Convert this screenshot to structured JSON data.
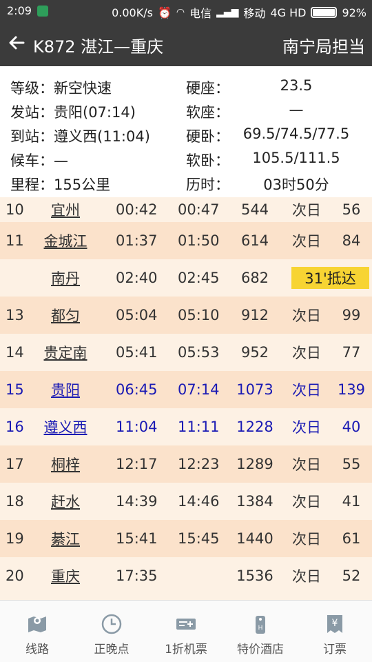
{
  "statusbar": {
    "time": "2:09",
    "speed": "0.00K/s",
    "carrier1": "电信",
    "carrier2": "移动",
    "network": "4G HD",
    "battery": "92%"
  },
  "appbar": {
    "title": "K872 湛江—重庆",
    "bureau": "南宁局担当"
  },
  "info": {
    "rows": [
      {
        "left": "等级：新空快速",
        "right_label": "硬座：",
        "right_value": "23.5"
      },
      {
        "left": "发站：贵阳(07:14)",
        "right_label": "软座：",
        "right_value": "—"
      },
      {
        "left": "到站：遵义西(11:04)",
        "right_label": "硬卧：",
        "right_value": "69.5/74.5/77.5"
      },
      {
        "left": "候车：—",
        "right_label": "软卧：",
        "right_value": "105.5/111.5"
      },
      {
        "left": "里程：155公里",
        "right_label": "历时：",
        "right_value": "03时50分"
      }
    ]
  },
  "stops": [
    {
      "num": "10",
      "name": "宜州",
      "arr": "00:42",
      "dep": "00:47",
      "km": "544",
      "day": "次日",
      "extra": "56"
    },
    {
      "num": "11",
      "name": "金城江",
      "arr": "01:37",
      "dep": "01:50",
      "km": "614",
      "day": "次日",
      "extra": "84"
    },
    {
      "num": "",
      "name": "南丹",
      "arr": "02:40",
      "dep": "02:45",
      "km": "682",
      "badge": "31'抵达"
    },
    {
      "num": "13",
      "name": "都匀",
      "arr": "05:04",
      "dep": "05:10",
      "km": "912",
      "day": "次日",
      "extra": "99"
    },
    {
      "num": "14",
      "name": "贵定南",
      "arr": "05:41",
      "dep": "05:53",
      "km": "952",
      "day": "次日",
      "extra": "77"
    },
    {
      "num": "15",
      "name": "贵阳",
      "arr": "06:45",
      "dep": "07:14",
      "km": "1073",
      "day": "次日",
      "extra": "139"
    },
    {
      "num": "16",
      "name": "遵义西",
      "arr": "11:04",
      "dep": "11:11",
      "km": "1228",
      "day": "次日",
      "extra": "40"
    },
    {
      "num": "17",
      "name": "桐梓",
      "arr": "12:17",
      "dep": "12:23",
      "km": "1289",
      "day": "次日",
      "extra": "55"
    },
    {
      "num": "18",
      "name": "赶水",
      "arr": "14:39",
      "dep": "14:46",
      "km": "1384",
      "day": "次日",
      "extra": "41"
    },
    {
      "num": "19",
      "name": "綦江",
      "arr": "15:41",
      "dep": "15:45",
      "km": "1440",
      "day": "次日",
      "extra": "61"
    },
    {
      "num": "20",
      "name": "重庆",
      "arr": "17:35",
      "dep": "",
      "km": "1536",
      "day": "次日",
      "extra": "52"
    }
  ],
  "highlight_color": "#1a1ab4",
  "badge_color": "#f7d433",
  "nav": [
    {
      "label": "线路",
      "icon": "map-icon"
    },
    {
      "label": "正晚点",
      "icon": "clock-icon"
    },
    {
      "label": "1折机票",
      "icon": "ticket-icon"
    },
    {
      "label": "特价酒店",
      "icon": "hotel-icon"
    },
    {
      "label": "订票",
      "icon": "yen-ticket-icon"
    }
  ]
}
